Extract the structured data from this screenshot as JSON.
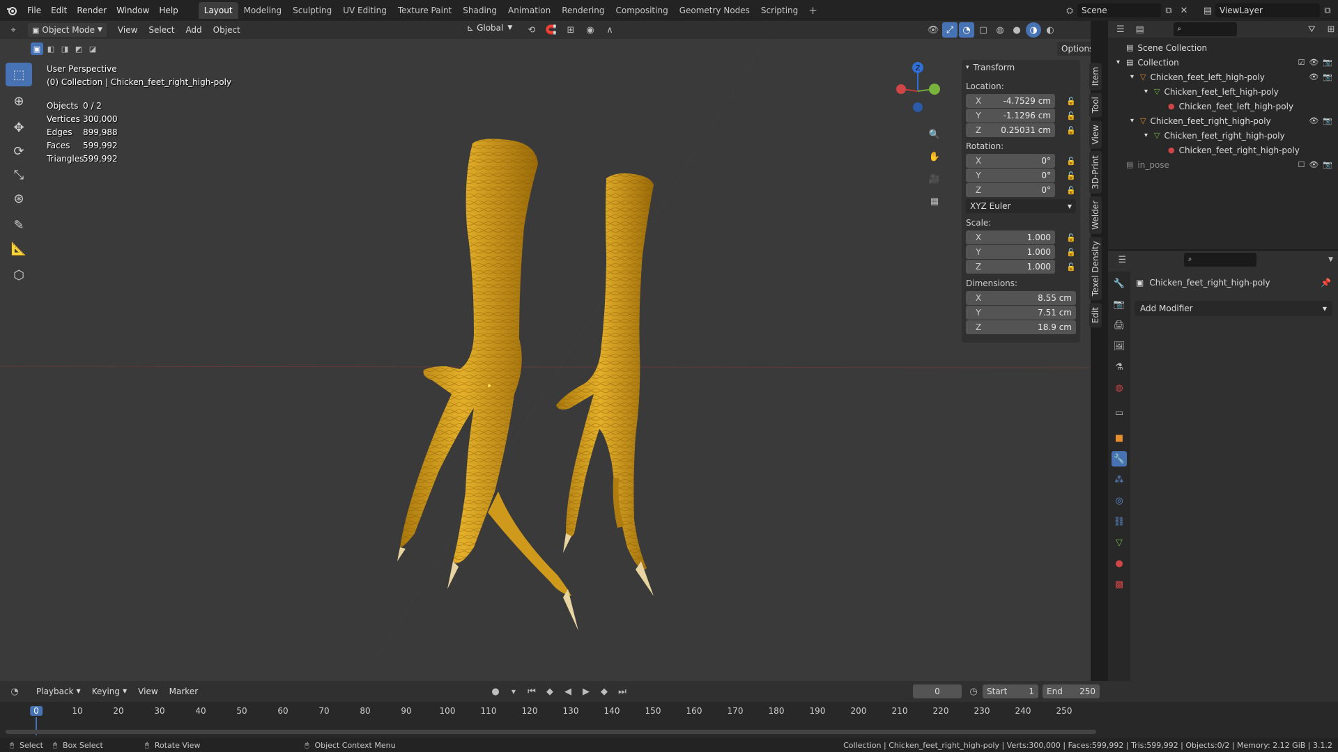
{
  "topbar": {
    "menus": [
      "File",
      "Edit",
      "Render",
      "Window",
      "Help"
    ],
    "workspaces": [
      "Layout",
      "Modeling",
      "Sculpting",
      "UV Editing",
      "Texture Paint",
      "Shading",
      "Animation",
      "Rendering",
      "Compositing",
      "Geometry Nodes",
      "Scripting"
    ],
    "active_workspace": "Layout",
    "add_tab": "+",
    "scene": "Scene",
    "view_layer": "ViewLayer"
  },
  "viewport_header": {
    "mode": "Object Mode",
    "menus": [
      "View",
      "Select",
      "Add",
      "Object"
    ],
    "orientation": "Global",
    "options": "Options"
  },
  "viewport": {
    "perspective": "User Perspective",
    "collection_line": "(0) Collection | Chicken_feet_right_high-poly",
    "stats": [
      {
        "label": "Objects",
        "value": "0 / 2"
      },
      {
        "label": "Vertices",
        "value": "300,000"
      },
      {
        "label": "Edges",
        "value": "899,988"
      },
      {
        "label": "Faces",
        "value": "599,992"
      },
      {
        "label": "Triangles",
        "value": "599,992"
      }
    ],
    "gizmo": {
      "z": "Z"
    }
  },
  "npanel": {
    "title": "Transform",
    "location_label": "Location:",
    "location": [
      {
        "ax": "X",
        "val": "-4.7529 cm"
      },
      {
        "ax": "Y",
        "val": "-1.1296 cm"
      },
      {
        "ax": "Z",
        "val": "0.25031 cm"
      }
    ],
    "rotation_label": "Rotation:",
    "rotation": [
      {
        "ax": "X",
        "val": "0°"
      },
      {
        "ax": "Y",
        "val": "0°"
      },
      {
        "ax": "Z",
        "val": "0°"
      }
    ],
    "rotation_mode": "XYZ Euler",
    "scale_label": "Scale:",
    "scale": [
      {
        "ax": "X",
        "val": "1.000"
      },
      {
        "ax": "Y",
        "val": "1.000"
      },
      {
        "ax": "Z",
        "val": "1.000"
      }
    ],
    "dimensions_label": "Dimensions:",
    "dimensions": [
      {
        "ax": "X",
        "val": "8.55 cm"
      },
      {
        "ax": "Y",
        "val": "7.51 cm"
      },
      {
        "ax": "Z",
        "val": "18.9 cm"
      }
    ],
    "tabs": [
      "Item",
      "Tool",
      "View",
      "3D-Print",
      "Welder",
      "Texel Density",
      "Edit"
    ]
  },
  "outliner": {
    "root": "Scene Collection",
    "items": [
      {
        "label": "Collection",
        "depth": 0,
        "kind": "collection"
      },
      {
        "label": "Chicken_feet_left_high-poly",
        "depth": 1,
        "kind": "object"
      },
      {
        "label": "Chicken_feet_left_high-poly",
        "depth": 2,
        "kind": "mesh"
      },
      {
        "label": "Chicken_feet_left_high-poly",
        "depth": 3,
        "kind": "material"
      },
      {
        "label": "Chicken_feet_right_high-poly",
        "depth": 1,
        "kind": "object"
      },
      {
        "label": "Chicken_feet_right_high-poly",
        "depth": 2,
        "kind": "mesh"
      },
      {
        "label": "Chicken_feet_right_high-poly",
        "depth": 3,
        "kind": "material"
      },
      {
        "label": "in_pose",
        "depth": 0,
        "kind": "collection-dim"
      }
    ]
  },
  "properties": {
    "object_name": "Chicken_feet_right_high-poly",
    "add_modifier": "Add Modifier"
  },
  "timeline": {
    "menus": [
      "Playback",
      "Keying",
      "View",
      "Marker"
    ],
    "current_frame": "0",
    "start_label": "Start",
    "start": "1",
    "end_label": "End",
    "end": "250",
    "ticks": [
      "0",
      "10",
      "20",
      "30",
      "40",
      "50",
      "60",
      "70",
      "80",
      "90",
      "100",
      "110",
      "120",
      "130",
      "140",
      "150",
      "160",
      "170",
      "180",
      "190",
      "200",
      "210",
      "220",
      "230",
      "240",
      "250"
    ]
  },
  "statusbar": {
    "select": "Select",
    "box_select": "Box Select",
    "rotate_view": "Rotate View",
    "context_menu": "Object Context Menu",
    "info": "Collection | Chicken_feet_right_high-poly | Verts:300,000 | Faces:599,992 | Tris:599,992 | Objects:0/2 | Memory: 2.12 GiB | 3.1.2"
  },
  "colors": {
    "accent": "#4772b3",
    "feet": "#d9a21a"
  }
}
